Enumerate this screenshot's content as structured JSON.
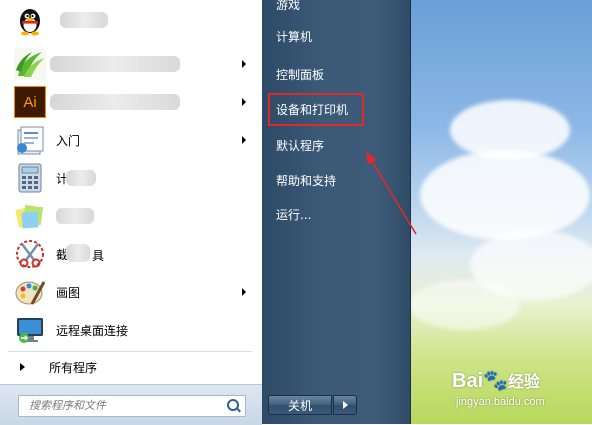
{
  "start_menu": {
    "programs": [
      {
        "label": "",
        "icon": "qq-penguin-icon",
        "blurred": true,
        "submenu": false
      },
      {
        "label": "",
        "icon": "green-leaf-app-icon",
        "blurred": true,
        "submenu": true
      },
      {
        "label": "",
        "icon": "adobe-illustrator-icon",
        "icon_text": "Ai",
        "blurred": true,
        "submenu": true
      },
      {
        "label": "入门",
        "icon": "getting-started-icon",
        "submenu": true
      },
      {
        "label": "计",
        "icon": "calculator-icon",
        "blurred": true,
        "submenu": false
      },
      {
        "label": "",
        "icon": "sticky-notes-icon",
        "blurred": true,
        "submenu": false
      },
      {
        "label": "截",
        "label_end": "具",
        "icon": "snipping-tool-icon",
        "blurred": true,
        "submenu": false
      },
      {
        "label": "画图",
        "icon": "paint-icon",
        "submenu": true
      },
      {
        "label": "远程桌面连接",
        "icon": "remote-desktop-icon",
        "submenu": false
      }
    ],
    "all_programs_label": "所有程序",
    "search_placeholder": "搜索程序和文件",
    "right_items": [
      "游戏",
      "计算机",
      "控制面板",
      "设备和打印机",
      "默认程序",
      "帮助和支持",
      "运行..."
    ],
    "highlighted_item": "设备和打印机",
    "shutdown_label": "关机"
  },
  "watermark": {
    "logo": "Bai",
    "logo_cn": "经验",
    "url": "jingyan.baidu.com"
  },
  "colors": {
    "annotation_red": "#e02a2a",
    "right_pane": "#3b5a78",
    "left_pane": "#ffffff"
  }
}
